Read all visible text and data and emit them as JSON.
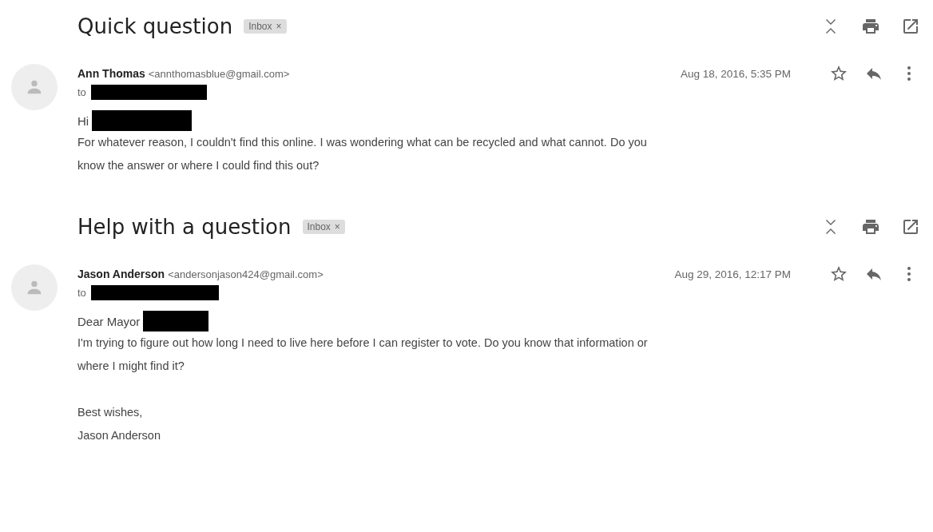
{
  "threads": [
    {
      "subject": "Quick question",
      "label": "Inbox",
      "label_close": "×",
      "message": {
        "sender_name": "Ann Thomas",
        "sender_email": "<annthomasblue@gmail.com>",
        "date": "Aug 18, 2016, 5:35 PM",
        "starred": false,
        "to_label": "to",
        "greeting": "Hi",
        "paragraphs": [
          [
            "For whatever reason, I couldn't find this online. I was wondering what can be recycled and what cannot. Do you",
            "know the answer or where I could find this out?"
          ]
        ]
      }
    },
    {
      "subject": "Help with a question",
      "label": "Inbox",
      "label_close": "×",
      "message": {
        "sender_name": "Jason Anderson",
        "sender_email": "<andersonjason424@gmail.com>",
        "date": "Aug 29, 2016, 12:17 PM",
        "starred": false,
        "to_label": "to",
        "greeting": "Dear Mayor",
        "paragraphs": [
          [
            "I'm trying to figure out how long I need to live here before I can register to vote. Do you know that information or",
            "where I might find it?"
          ],
          [
            "Best wishes,",
            "Jason Anderson"
          ]
        ]
      }
    }
  ]
}
